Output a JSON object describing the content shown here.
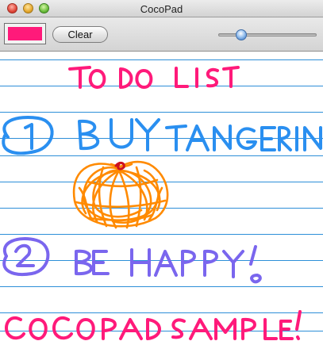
{
  "window": {
    "title": "CocoPad"
  },
  "toolbar": {
    "clear_label": "Clear",
    "current_color": "#ff1a7a",
    "brush_size_fraction": 0.23
  },
  "colors": {
    "pink": "#ff1a7a",
    "blue": "#2a8ff0",
    "orange": "#ff8a00",
    "red": "#cc1020",
    "purple": "#7a66ee",
    "ruled_line": "#2d8fd8"
  },
  "drawing": {
    "icons": [
      "tangerine-sketch",
      "handwriting-strokes"
    ]
  }
}
